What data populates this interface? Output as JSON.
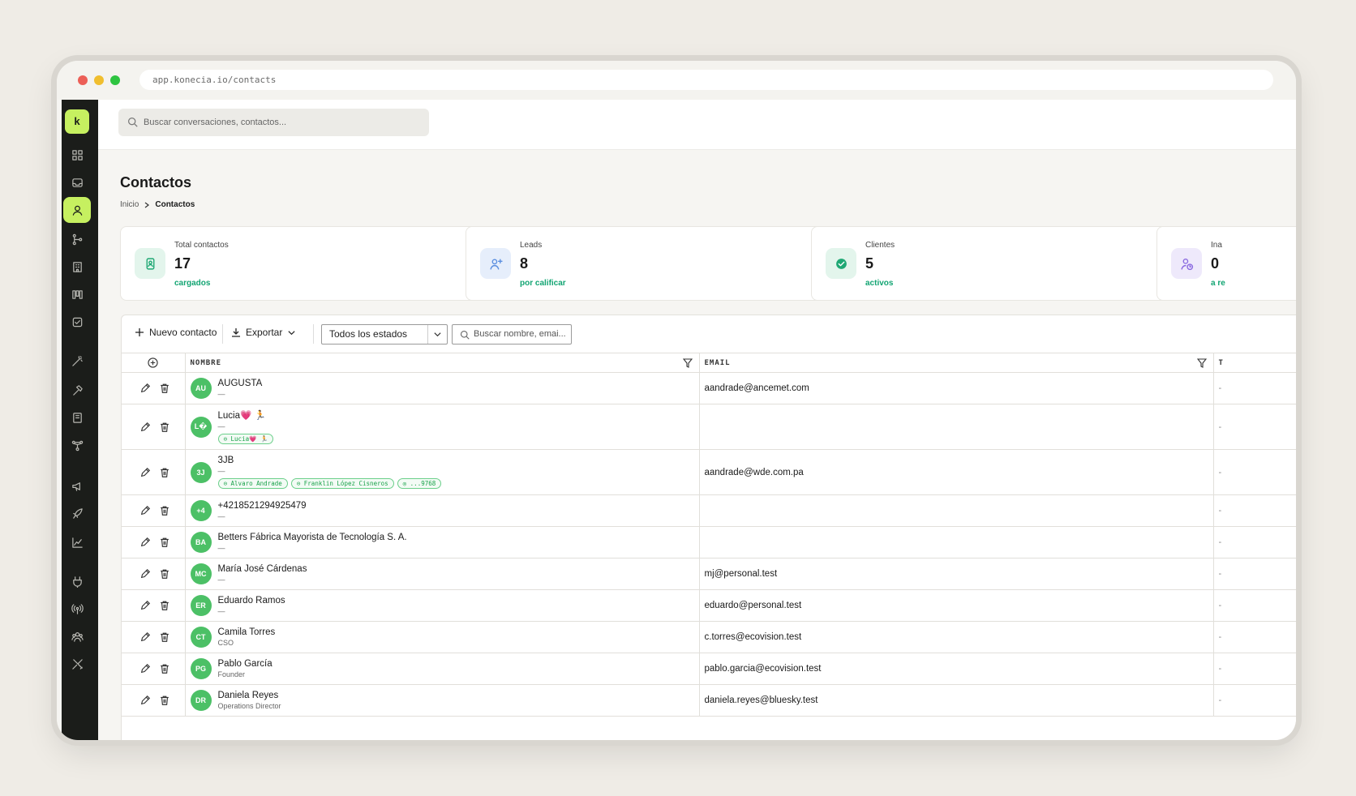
{
  "browser": {
    "url": "app.konecia.io/contacts"
  },
  "app": {
    "logo_letter": "k",
    "search_placeholder": "Buscar conversaciones, contactos..."
  },
  "sidebar": {
    "items": [
      {
        "icon": "grid-icon"
      },
      {
        "icon": "inbox-icon"
      },
      {
        "icon": "user-icon",
        "active": true
      },
      {
        "icon": "flow-icon"
      },
      {
        "icon": "building-icon"
      },
      {
        "icon": "kanban-icon"
      },
      {
        "icon": "task-icon"
      },
      {
        "icon": "wand-icon"
      },
      {
        "icon": "hammer-icon"
      },
      {
        "icon": "book-icon"
      },
      {
        "icon": "network-icon"
      },
      {
        "icon": "megaphone-icon"
      },
      {
        "icon": "rocket-icon"
      },
      {
        "icon": "chart-icon"
      },
      {
        "icon": "plug-icon"
      },
      {
        "icon": "broadcast-icon"
      },
      {
        "icon": "team-icon"
      },
      {
        "icon": "tools-icon"
      }
    ]
  },
  "page": {
    "title": "Contactos",
    "breadcrumb": [
      "Inicio",
      "Contactos"
    ]
  },
  "stats": [
    {
      "label": "Total contactos",
      "value": "17",
      "sub": "cargados",
      "icon": "contact-card-icon",
      "bg": "#e3f5ec",
      "fg": "#1fa874"
    },
    {
      "label": "Leads",
      "value": "8",
      "sub": "por calificar",
      "icon": "user-plus-icon",
      "bg": "#e6eefb",
      "fg": "#5b8fe0"
    },
    {
      "label": "Clientes",
      "value": "5",
      "sub": "activos",
      "icon": "check-circle-icon",
      "bg": "#e3f5ec",
      "fg": "#1fa874"
    },
    {
      "label": "Ina",
      "value": "0",
      "sub": "a re",
      "icon": "user-clock-icon",
      "bg": "#eee9fb",
      "fg": "#8a6ae0"
    }
  ],
  "toolbar": {
    "new_contact": "Nuevo contacto",
    "export": "Exportar",
    "status_filter": "Todos los estados",
    "search_placeholder": "Buscar nombre, emai..."
  },
  "table": {
    "columns": [
      "NOMBRE",
      "EMAIL",
      "T"
    ],
    "rows": [
      {
        "initials": "AU",
        "name": "AUGUSTA",
        "sub": "—",
        "email": "aandrade@ancemet.com",
        "tags": [],
        "extra": "-"
      },
      {
        "initials": "L�",
        "name": "Lucia💗 🏃",
        "sub": "—",
        "email": "",
        "tags": [
          "⊙ Lucia💗 🏃"
        ],
        "extra": "-"
      },
      {
        "initials": "3J",
        "name": "3JB",
        "sub": "—",
        "email": "aandrade@wde.com.pa",
        "tags": [
          "⊙ Alvaro Andrade",
          "⊙ Franklin López Cisneros",
          "◎ ...9768"
        ],
        "extra": "-"
      },
      {
        "initials": "+4",
        "name": "+4218521294925479",
        "sub": "—",
        "email": "",
        "tags": [],
        "extra": "-"
      },
      {
        "initials": "BA",
        "name": "Betters Fábrica Mayorista de Tecnología S. A.",
        "sub": "—",
        "email": "",
        "tags": [],
        "extra": "-"
      },
      {
        "initials": "MC",
        "name": "María José Cárdenas",
        "sub": "—",
        "email": "mj@personal.test",
        "tags": [],
        "extra": "-"
      },
      {
        "initials": "ER",
        "name": "Eduardo Ramos",
        "sub": "—",
        "email": "eduardo@personal.test",
        "tags": [],
        "extra": "-"
      },
      {
        "initials": "CT",
        "name": "Camila Torres",
        "sub": "CSO",
        "email": "c.torres@ecovision.test",
        "tags": [],
        "extra": "-"
      },
      {
        "initials": "PG",
        "name": "Pablo García",
        "sub": "Founder",
        "email": "pablo.garcia@ecovision.test",
        "tags": [],
        "extra": "-"
      },
      {
        "initials": "DR",
        "name": "Daniela Reyes",
        "sub": "Operations Director",
        "email": "daniela.reyes@bluesky.test",
        "tags": [],
        "extra": "-"
      }
    ]
  }
}
